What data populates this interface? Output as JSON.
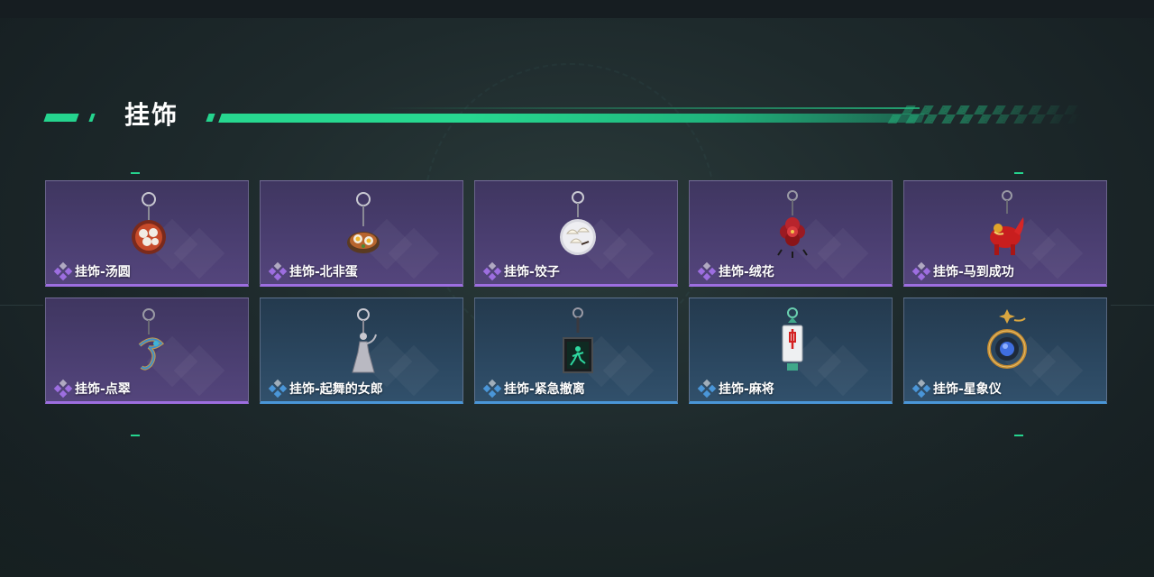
{
  "header": {
    "title": "挂饰"
  },
  "colors": {
    "accent_green": "#25d48e",
    "rare_purple": "#9d6ee0",
    "uncommon_blue": "#4a96d8"
  },
  "items": [
    {
      "label": "挂饰-汤圆",
      "rarity": "purple",
      "icon": "tangyuan-bowl-icon"
    },
    {
      "label": "挂饰-北非蛋",
      "rarity": "purple",
      "icon": "shakshuka-pan-icon"
    },
    {
      "label": "挂饰-饺子",
      "rarity": "purple",
      "icon": "dumpling-plate-icon"
    },
    {
      "label": "挂饰-绒花",
      "rarity": "purple",
      "icon": "velvet-flower-icon"
    },
    {
      "label": "挂饰-马到成功",
      "rarity": "purple",
      "icon": "red-horse-icon"
    },
    {
      "label": "挂饰-点翠",
      "rarity": "purple",
      "icon": "kingfisher-ornament-icon"
    },
    {
      "label": "挂饰-起舞的女郎",
      "rarity": "blue",
      "icon": "dancing-lady-icon"
    },
    {
      "label": "挂饰-紧急撤离",
      "rarity": "blue",
      "icon": "emergency-exit-icon"
    },
    {
      "label": "挂饰-麻将",
      "rarity": "blue",
      "icon": "mahjong-tile-icon"
    },
    {
      "label": "挂饰-星象仪",
      "rarity": "blue",
      "icon": "astrolabe-icon"
    }
  ]
}
